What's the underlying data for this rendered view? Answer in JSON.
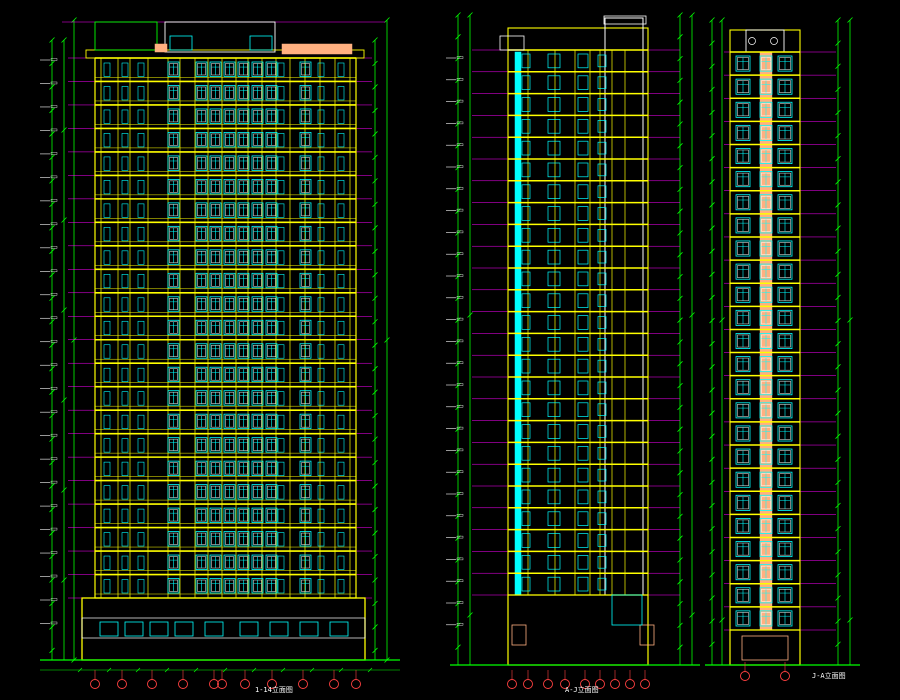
{
  "drawing": {
    "background": "#000000",
    "floors_main": 23,
    "floors_side": 25,
    "left_caption": "1-14立面图",
    "mid_caption": "A-J立面图",
    "right_caption": "J-A立面图",
    "colors": {
      "dimension": "#00ff00",
      "floor_line": "#ffff00",
      "level_line": "#ff00ff",
      "window": "#00ffff",
      "mullion": "#ffffff",
      "accent_wall": "#ffb080",
      "axis_bubble": "#ff4040",
      "text": "#ffffff"
    }
  }
}
